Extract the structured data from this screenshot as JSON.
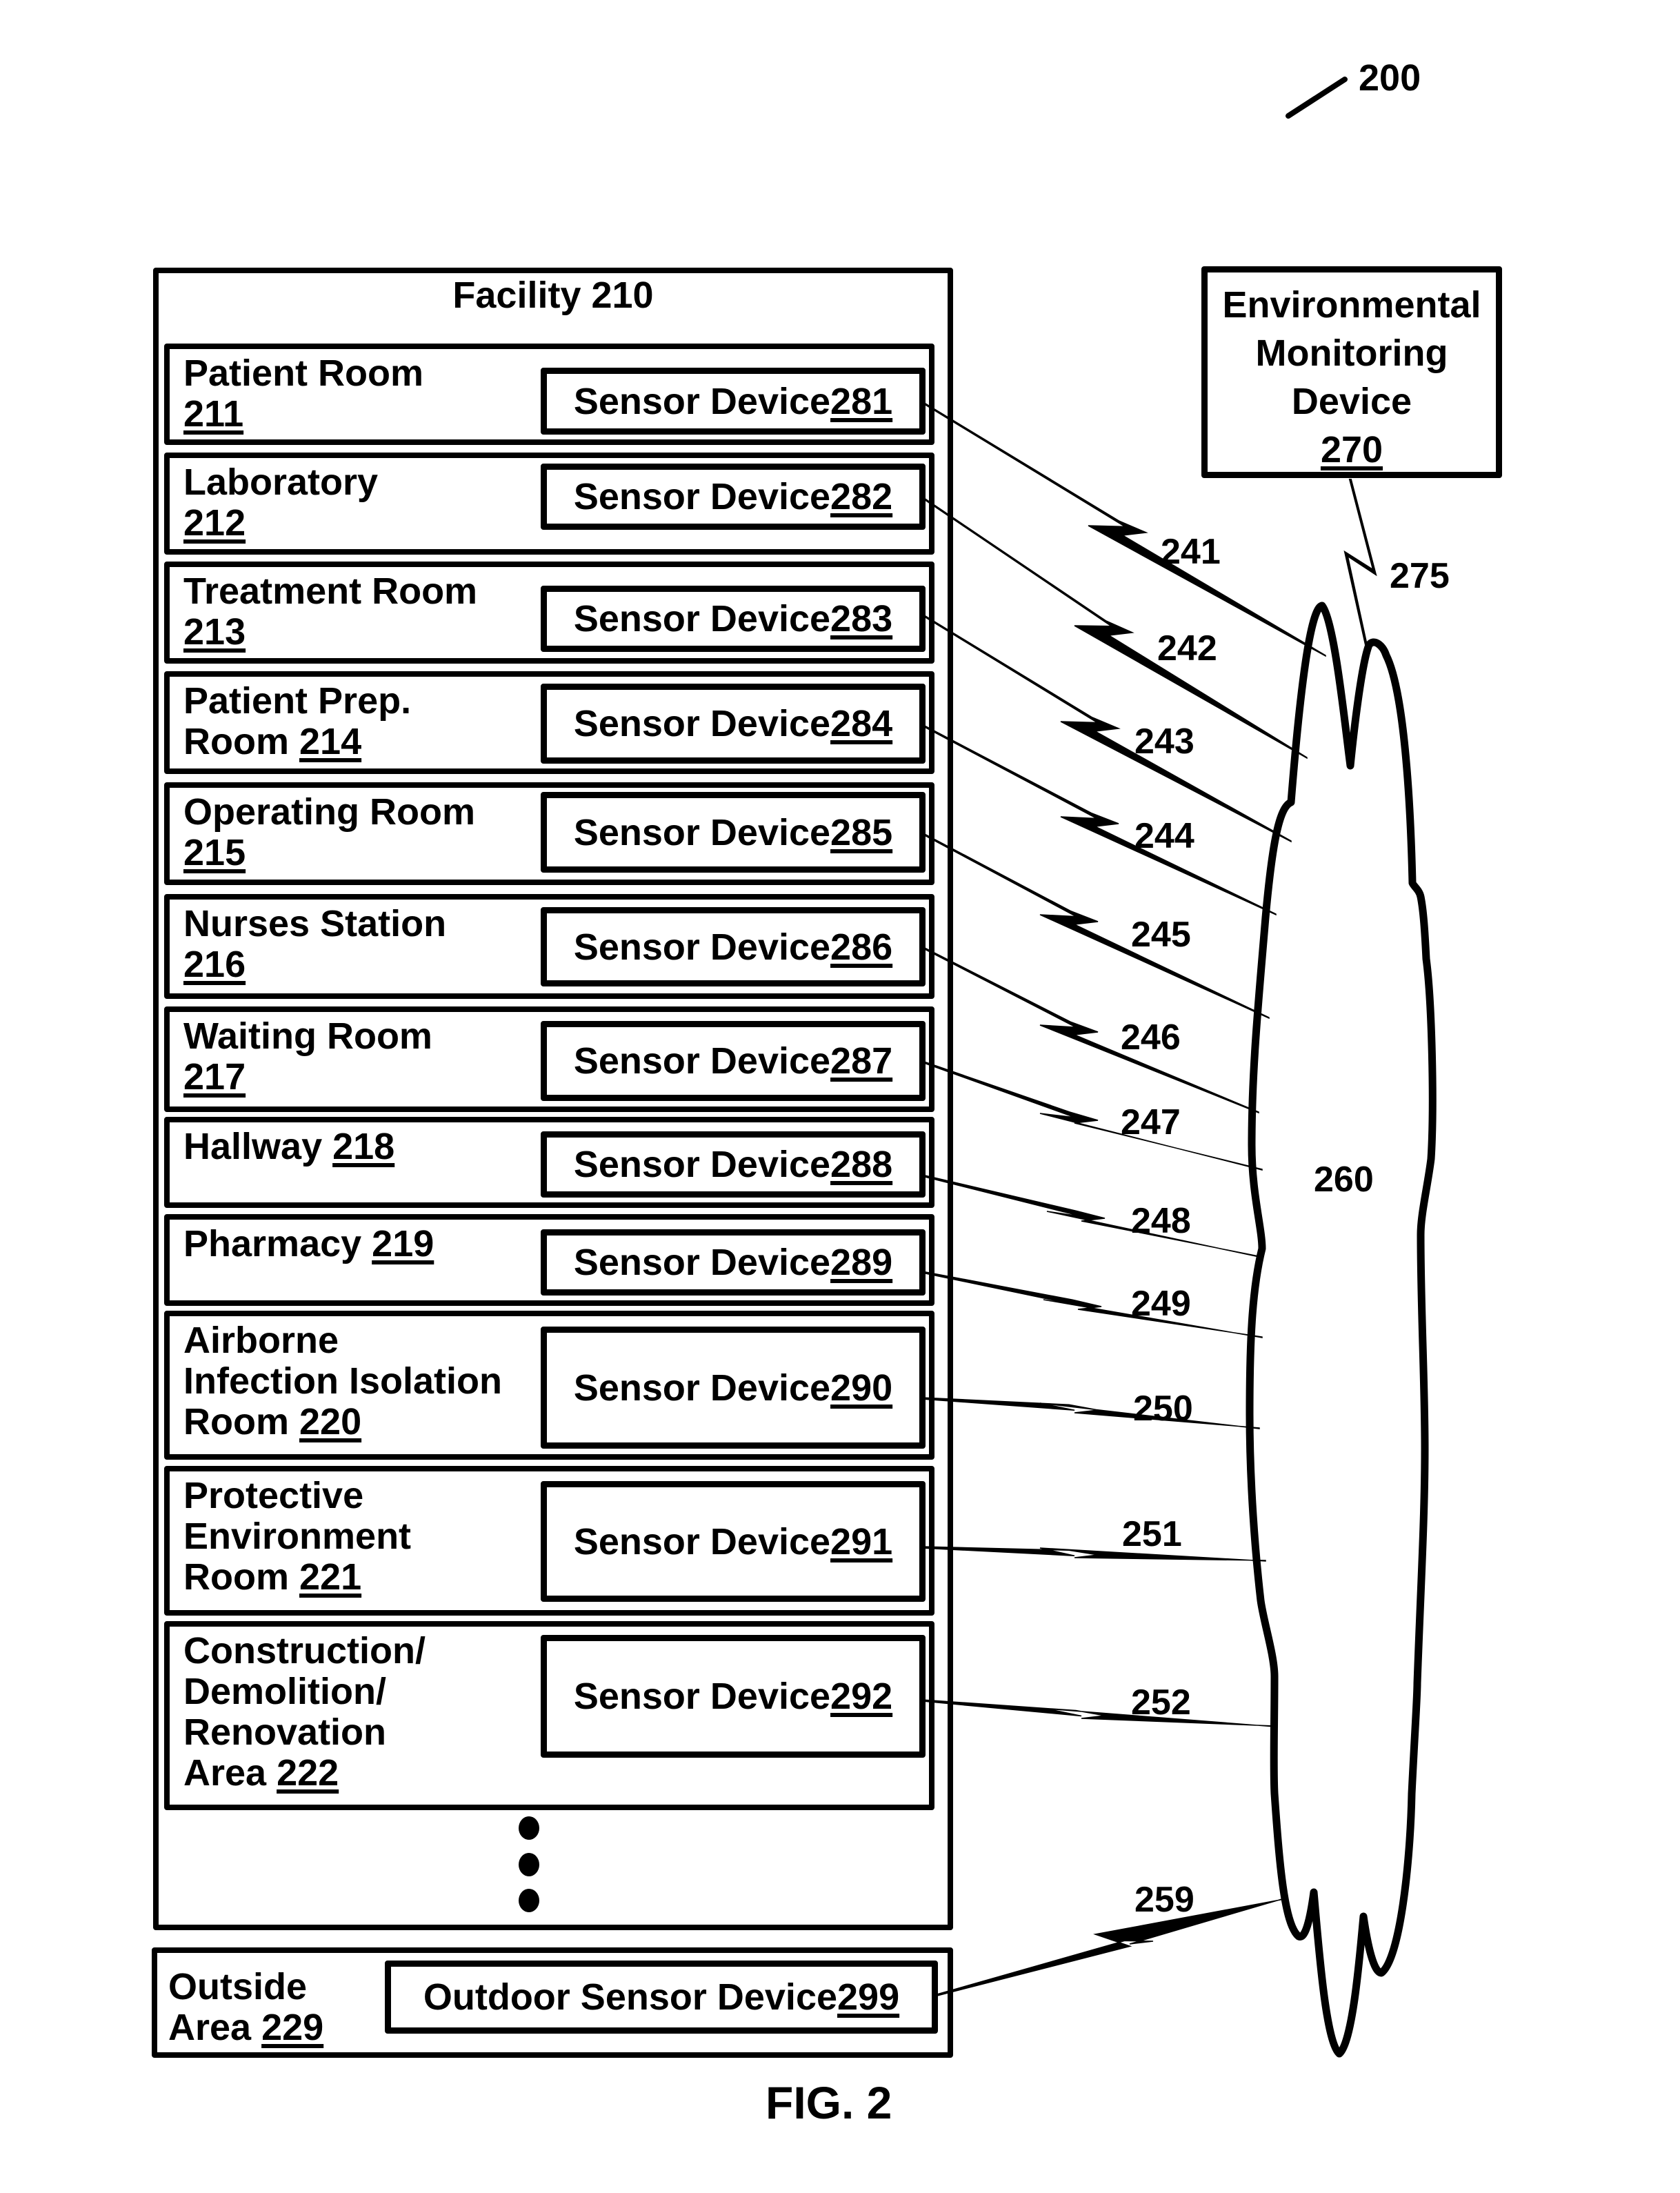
{
  "figure": {
    "ref": "200",
    "caption": "FIG. 2"
  },
  "facility": {
    "title_text": "Facility ",
    "title_ref": "210",
    "rooms": [
      {
        "label_lines": [
          "Patient Room"
        ],
        "label_tail": "",
        "ref": "211",
        "ref_own_line": true,
        "sensor_text": "Sensor Device ",
        "sensor_ref": "281",
        "link": "241"
      },
      {
        "label_lines": [
          "Laboratory"
        ],
        "label_tail": "",
        "ref": "212",
        "ref_own_line": true,
        "sensor_text": "Sensor Device ",
        "sensor_ref": "282",
        "link": "242"
      },
      {
        "label_lines": [
          "Treatment Room"
        ],
        "label_tail": "",
        "ref": "213",
        "ref_own_line": true,
        "sensor_text": "Sensor Device ",
        "sensor_ref": "283",
        "link": "243"
      },
      {
        "label_lines": [
          "Patient Prep."
        ],
        "label_tail": "Room ",
        "ref": "214",
        "ref_own_line": false,
        "sensor_text": "Sensor Device ",
        "sensor_ref": "284",
        "link": "244"
      },
      {
        "label_lines": [
          "Operating Room"
        ],
        "label_tail": "",
        "ref": "215",
        "ref_own_line": true,
        "sensor_text": "Sensor Device ",
        "sensor_ref": "285",
        "link": "245"
      },
      {
        "label_lines": [
          "Nurses Station"
        ],
        "label_tail": "",
        "ref": "216",
        "ref_own_line": true,
        "sensor_text": "Sensor Device ",
        "sensor_ref": "286",
        "link": "246"
      },
      {
        "label_lines": [
          "Waiting Room"
        ],
        "label_tail": "",
        "ref": "217",
        "ref_own_line": true,
        "sensor_text": "Sensor Device ",
        "sensor_ref": "287",
        "link": "247"
      },
      {
        "label_lines": [],
        "label_tail": "Hallway ",
        "ref": "218",
        "ref_own_line": false,
        "sensor_text": "Sensor Device ",
        "sensor_ref": "288",
        "link": "248"
      },
      {
        "label_lines": [],
        "label_tail": "Pharmacy ",
        "ref": "219",
        "ref_own_line": false,
        "sensor_text": "Sensor Device ",
        "sensor_ref": "289",
        "link": "249"
      },
      {
        "label_lines": [
          "Airborne",
          "Infection Isolation"
        ],
        "label_tail": "Room ",
        "ref": "220",
        "ref_own_line": false,
        "sensor_text": "Sensor Device ",
        "sensor_ref": "290",
        "link": "250"
      },
      {
        "label_lines": [
          "Protective",
          "Environment"
        ],
        "label_tail": "Room ",
        "ref": "221",
        "ref_own_line": false,
        "sensor_text": "Sensor Device ",
        "sensor_ref": "291",
        "link": "251"
      },
      {
        "label_lines": [
          "Construction/",
          "Demolition/",
          "Renovation"
        ],
        "label_tail": "Area ",
        "ref": "222",
        "ref_own_line": false,
        "sensor_text": "Sensor Device ",
        "sensor_ref": "292",
        "link": "252"
      }
    ],
    "continuation": "more rooms (ellipsis)"
  },
  "outside": {
    "label_lines": [
      "Outside"
    ],
    "label_tail": "Area ",
    "ref": "229",
    "sensor_text": "Outdoor Sensor Device ",
    "sensor_ref": "299",
    "link": "259"
  },
  "environmental_monitoring_device": {
    "label_lines": [
      "Environmental",
      "Monitoring",
      "Device"
    ],
    "ref": "270",
    "link": "275"
  },
  "network": {
    "ref": "260"
  }
}
